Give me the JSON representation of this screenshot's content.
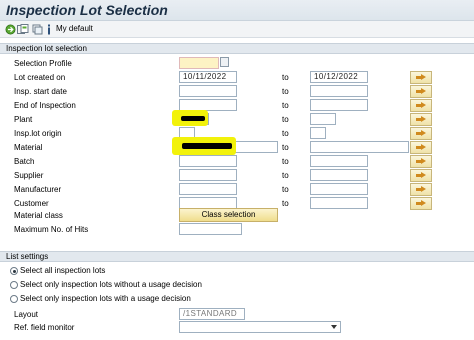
{
  "window": {
    "title": "Inspection Lot Selection"
  },
  "toolbar": {
    "variant_label": "My default"
  },
  "group1": {
    "title": "Inspection lot selection",
    "to_label": "to",
    "rows": [
      {
        "label": "Selection Profile",
        "low": "",
        "high": ""
      },
      {
        "label": "Lot created on",
        "low": "10/11/2022",
        "high": "10/12/2022"
      },
      {
        "label": "Insp. start date",
        "low": "",
        "high": ""
      },
      {
        "label": "End of Inspection",
        "low": "",
        "high": ""
      },
      {
        "label": "Plant",
        "low": "",
        "high": ""
      },
      {
        "label": "Insp.lot origin",
        "low": "",
        "high": ""
      },
      {
        "label": "Material",
        "low": "",
        "high": ""
      },
      {
        "label": "Batch",
        "low": "",
        "high": ""
      },
      {
        "label": "Supplier",
        "low": "",
        "high": ""
      },
      {
        "label": "Manufacturer",
        "low": "",
        "high": ""
      },
      {
        "label": "Customer",
        "low": "",
        "high": ""
      },
      {
        "label": "Material class",
        "button": "Class selection"
      },
      {
        "label": "Maximum No. of Hits",
        "low": ""
      }
    ]
  },
  "group2": {
    "title": "List settings",
    "radios": [
      {
        "label": "Select all inspection lots",
        "selected": true
      },
      {
        "label": "Select only inspection lots without a usage decision",
        "selected": false
      },
      {
        "label": "Select only inspection lots with a usage decision",
        "selected": false
      }
    ],
    "layout_label": "Layout",
    "layout_value": "/1STANDARD",
    "ref_field_label": "Ref. field monitor",
    "ref_field_value": ""
  },
  "colors": {
    "highlight": "#f2f20a",
    "required_field": "#fdf3c4",
    "title_text": "#1b2f45"
  },
  "icons": [
    "execute-icon",
    "save-variant-icon",
    "info-icon",
    "multiple-selection-icon"
  ]
}
